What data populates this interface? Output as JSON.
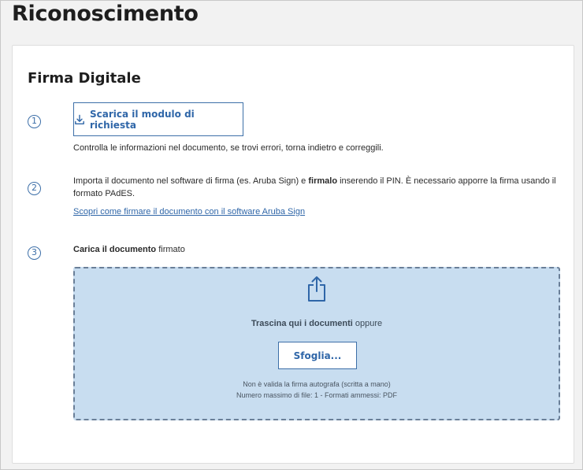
{
  "page": {
    "title": "Riconoscimento"
  },
  "card": {
    "section_title": "Firma Digitale",
    "steps": [
      {
        "number": "1",
        "button_label": "Scarica il modulo di richiesta",
        "button_icon": "download-icon",
        "description": "Controlla le informazioni nel documento, se trovi errori, torna indietro e correggili."
      },
      {
        "number": "2",
        "description_part1": "Importa il documento nel software di firma (es. Aruba Sign) e ",
        "description_bold": "firmalo",
        "description_part2": " inserendo il PIN. È necessario apporre la firma usando il formato PAdES.",
        "link_label": "Scopri come firmare il documento con il software Aruba Sign"
      },
      {
        "number": "3",
        "label_bold": "Carica il documento",
        "label_rest": " firmato"
      }
    ],
    "dropzone": {
      "icon": "upload-share-icon",
      "drag_text_bold": "Trascina qui i documenti",
      "drag_text_rest": " oppure",
      "browse_label": "Sfoglia...",
      "note_1": "Non è valida la firma autografa (scritta a mano)",
      "note_2": "Numero massimo di file: 1 - Formati ammessi: PDF"
    }
  },
  "colors": {
    "accent": "#2f66a8",
    "dropzone_bg": "#c8ddf0",
    "page_bg": "#f2f2f2"
  }
}
